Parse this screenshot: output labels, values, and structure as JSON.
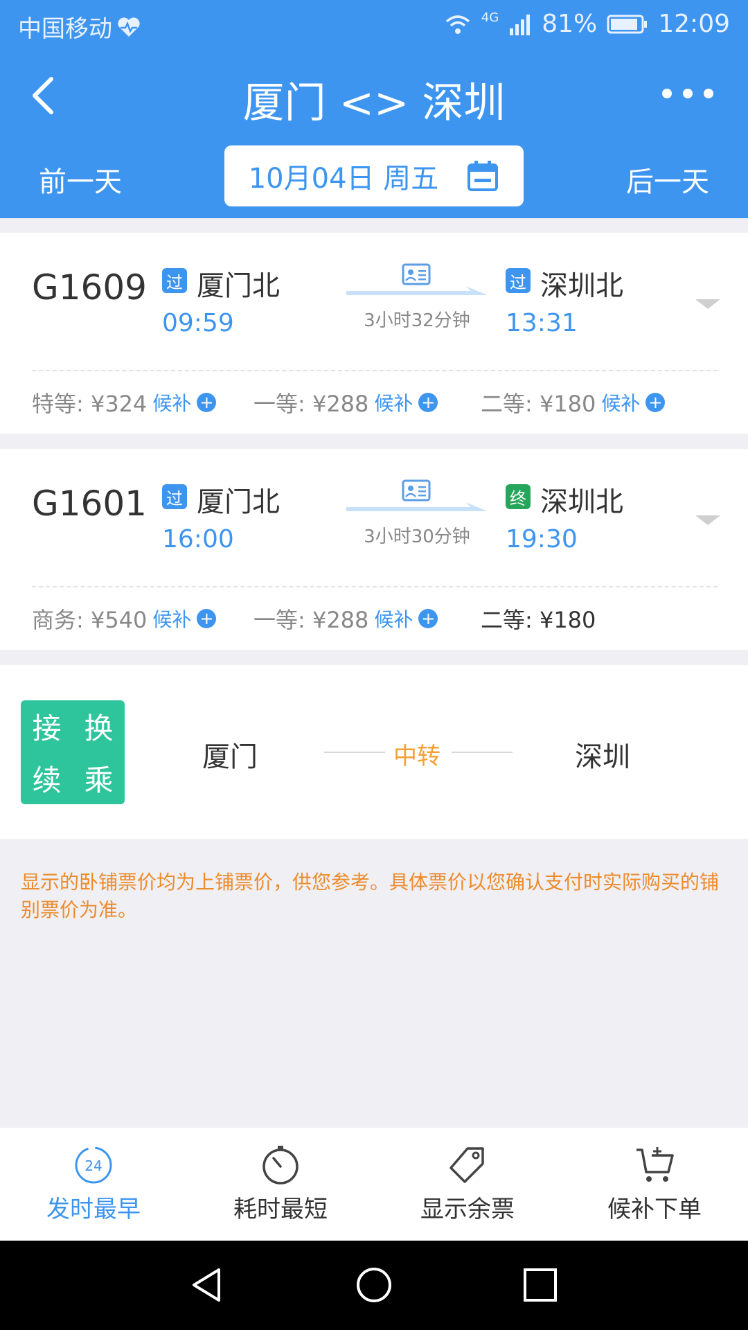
{
  "status_bar": {
    "carrier": "中国移动",
    "network": "4G",
    "battery": "81%",
    "time": "12:09"
  },
  "header": {
    "title": "厦门 <> 深圳",
    "prev_day": "前一天",
    "next_day": "后一天",
    "date": "10月04日 周五"
  },
  "trains": [
    {
      "number": "G1609",
      "from_badge": "过",
      "from_station": "厦门北",
      "depart": "09:59",
      "duration": "3小时32分钟",
      "to_badge": "过",
      "to_station": "深圳北",
      "arrive": "13:31",
      "prices": [
        {
          "label": "特等: ¥324",
          "houbu": "候补"
        },
        {
          "label": "一等: ¥288",
          "houbu": "候补"
        },
        {
          "label": "二等: ¥180",
          "houbu": "候补"
        }
      ]
    },
    {
      "number": "G1601",
      "from_badge": "过",
      "from_station": "厦门北",
      "depart": "16:00",
      "duration": "3小时30分钟",
      "to_badge": "终",
      "to_station": "深圳北",
      "arrive": "19:30",
      "prices": [
        {
          "label": "商务: ¥540",
          "houbu": "候补"
        },
        {
          "label": "一等: ¥288",
          "houbu": "候补"
        },
        {
          "label": "二等: ¥180",
          "houbu": ""
        }
      ]
    }
  ],
  "transfer": {
    "box": [
      "接",
      "换",
      "续",
      "乘"
    ],
    "from": "厦门",
    "mid": "中转",
    "to": "深圳"
  },
  "note": "显示的卧铺票价均为上铺票价，供您参考。具体票价以您确认支付时实际购买的铺别票价为准。",
  "tabs": [
    {
      "label": "发时最早",
      "icon": "clock-24-icon"
    },
    {
      "label": "耗时最短",
      "icon": "timer-icon"
    },
    {
      "label": "显示余票",
      "icon": "tag-icon"
    },
    {
      "label": "候补下单",
      "icon": "cart-plus-icon"
    }
  ],
  "clock_badge": "24",
  "colors": {
    "primary": "#3d95f0",
    "transfer_green": "#2ec59c",
    "note_orange": "#ee8b2b",
    "end_badge": "#26a65b"
  }
}
